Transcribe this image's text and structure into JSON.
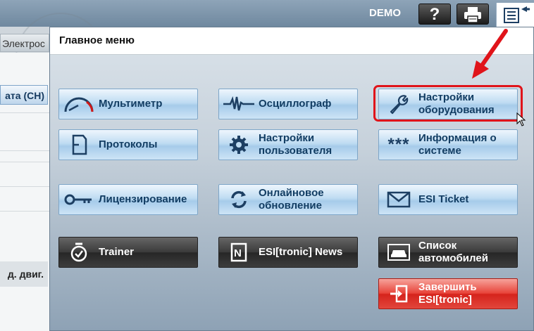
{
  "topbar": {
    "mode_label": "DEMO",
    "help_label": "?",
    "print_icon": "printer-icon",
    "menu_icon": "menu-list-icon"
  },
  "background": {
    "tab_label": "Электрос",
    "date_button": "ата (СН)",
    "engine_label": "д. двиг."
  },
  "menu": {
    "title": "Главное меню",
    "buttons": [
      {
        "id": "multimeter",
        "label": "Мультиметр",
        "icon": "gauge-icon"
      },
      {
        "id": "oscilloscope",
        "label": "Осциллограф",
        "icon": "waveform-icon"
      },
      {
        "id": "equipment-settings",
        "label": "Настройки оборудования",
        "icon": "wrench-icon"
      },
      {
        "id": "protocols",
        "label": "Протоколы",
        "icon": "document-icon"
      },
      {
        "id": "user-settings",
        "label": "Настройки пользователя",
        "icon": "gear-icon"
      },
      {
        "id": "system-info",
        "label": "Информация о системе",
        "icon": "asterisks-icon"
      },
      {
        "id": "licensing",
        "label": "Лицензирование",
        "icon": "key-icon"
      },
      {
        "id": "online-update",
        "label": "Онлайновое обновление",
        "icon": "refresh-icon"
      },
      {
        "id": "esi-ticket",
        "label": "ESI Ticket",
        "icon": "envelope-icon"
      },
      {
        "id": "trainer",
        "label": "Trainer",
        "icon": "stopwatch-icon"
      },
      {
        "id": "esitronic-news",
        "label": "ESI[tronic] News",
        "icon": "news-icon"
      },
      {
        "id": "vehicle-list",
        "label": "Список автомобилей",
        "icon": "car-icon"
      },
      {
        "id": "exit",
        "label": "Завершить ESI[tronic]",
        "icon": "exit-icon"
      }
    ]
  },
  "colors": {
    "highlight": "#e0141a",
    "button_blue_text": "#123d63",
    "exit_red": "#d5231c"
  }
}
